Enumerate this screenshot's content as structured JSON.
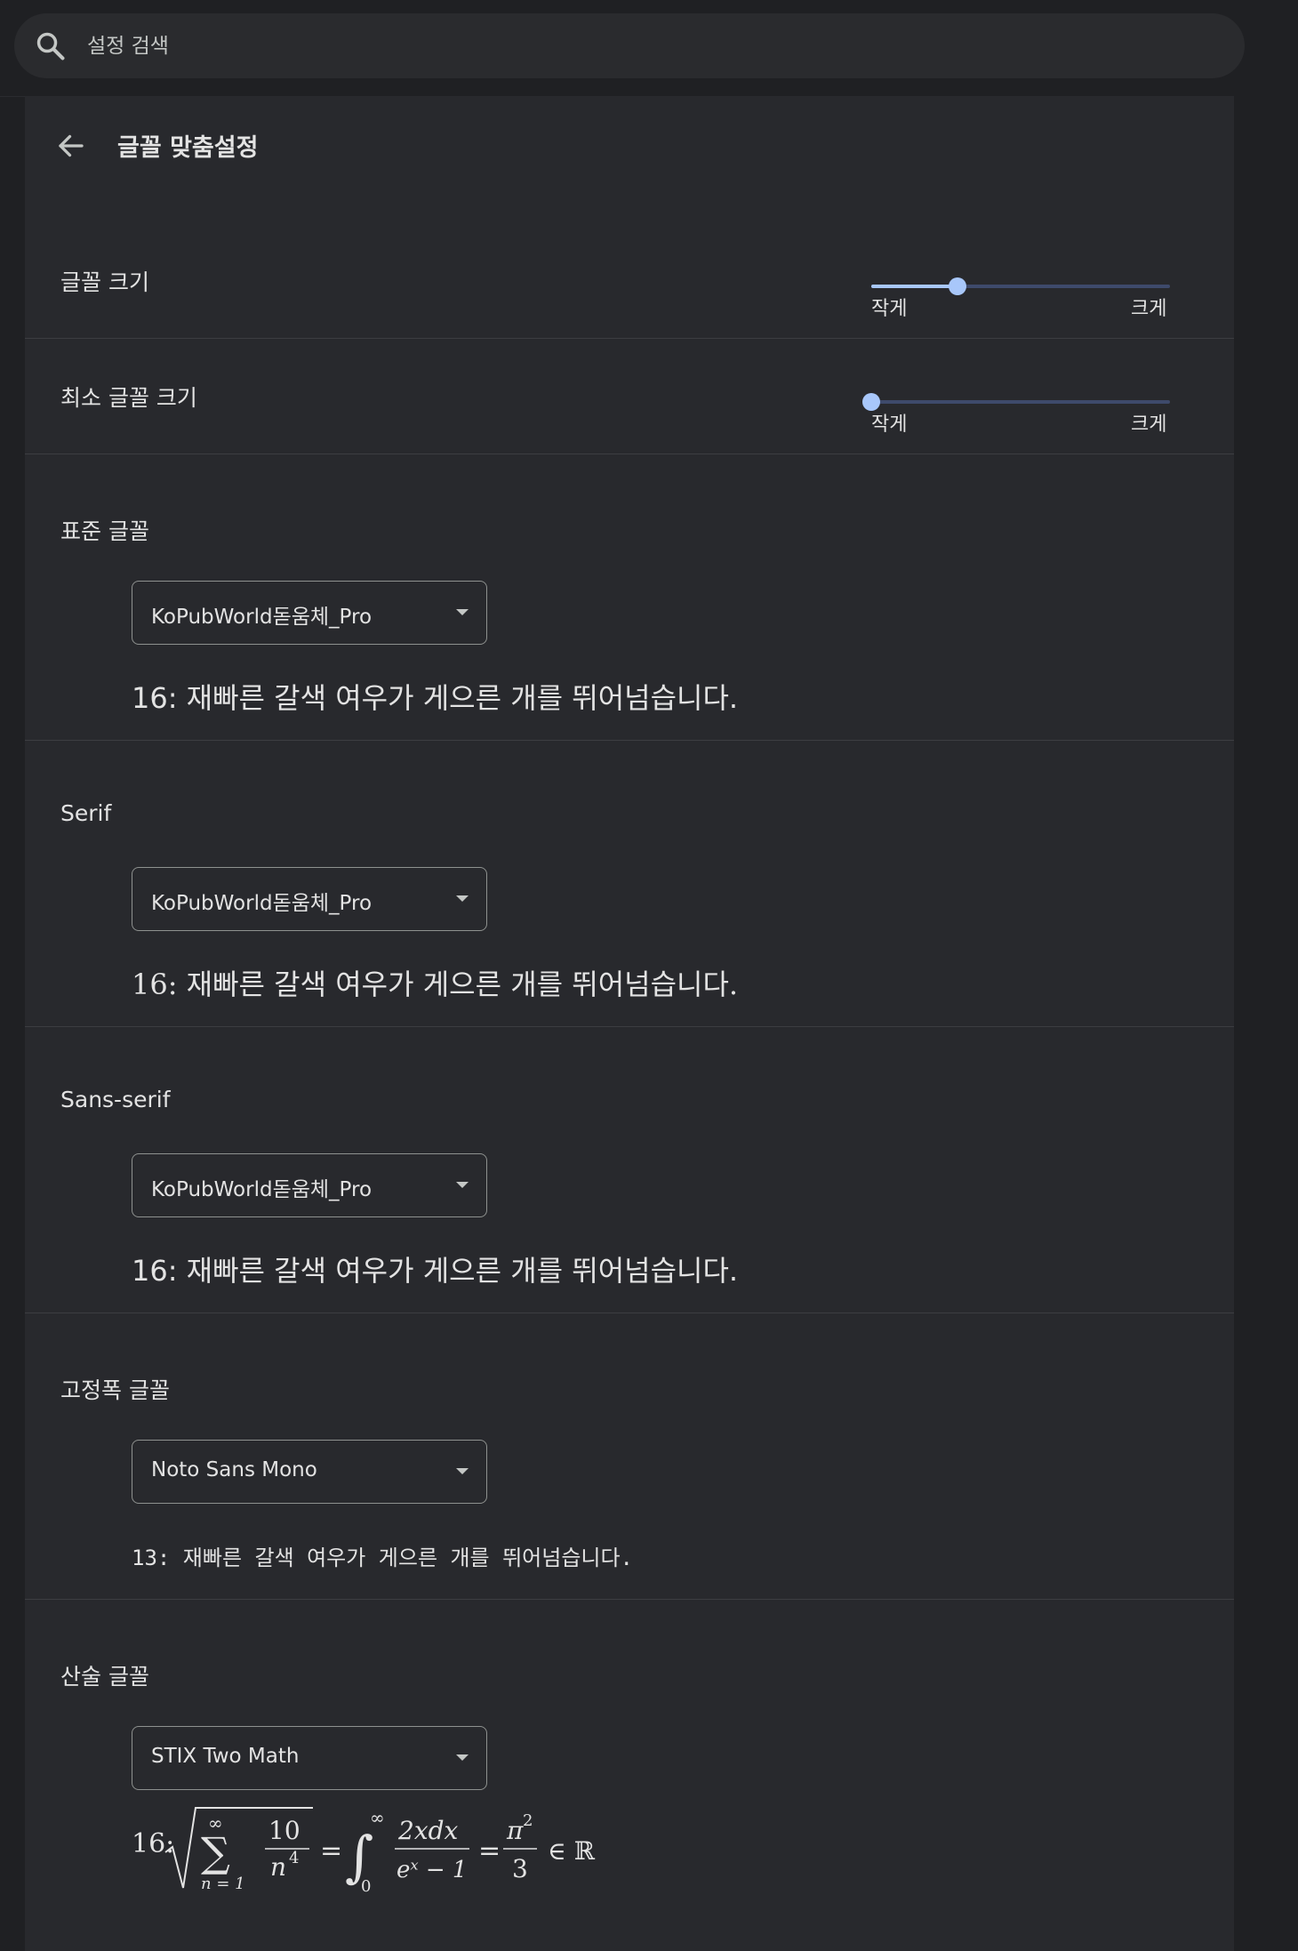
{
  "search": {
    "placeholder": "설정 검색"
  },
  "header": {
    "title": "글꼴 맞춤설정"
  },
  "font_size": {
    "label": "글꼴 크기",
    "min_label": "작게",
    "max_label": "크게",
    "value_fraction": 0.29
  },
  "min_font_size": {
    "label": "최소 글꼴 크기",
    "min_label": "작게",
    "max_label": "크게",
    "value_fraction": 0.0
  },
  "standard_font": {
    "label": "표준 글꼴",
    "selected": "KoPubWorld돋움체_Pro",
    "sample": "16: 재빠른 갈색 여우가 게으른 개를 뛰어넘습니다."
  },
  "serif_font": {
    "label": "Serif",
    "selected": "KoPubWorld돋움체_Pro",
    "sample": "16: 재빠른 갈색 여우가 게으른 개를 뛰어넘습니다."
  },
  "sans_serif_font": {
    "label": "Sans-serif",
    "selected": "KoPubWorld돋움체_Pro",
    "sample": "16: 재빠른 갈색 여우가 게으른 개를 뛰어넘습니다."
  },
  "fixed_width_font": {
    "label": "고정폭 글꼴",
    "selected": "Noto Sans Mono",
    "sample": "13: 재빠른 갈색 여우가 게으른 개를 뛰어넘습니다."
  },
  "math_font": {
    "label": "산술 글꼴",
    "selected": "STIX Two Math",
    "sample_prefix": "16:",
    "sum_top": "∞",
    "sum_symbol": "∑",
    "sum_bottom": "n = 1",
    "frac1_num": "10",
    "frac1_den": "n",
    "frac1_den_exp": "4",
    "equals": "=",
    "integral": "∫",
    "int_upper": "∞",
    "int_lower": "0",
    "frac2_num": "2xdx",
    "frac2_den": "eˣ − 1",
    "frac3_num": "π",
    "frac3_num_exp": "2",
    "frac3_den": "3",
    "element_of": "∈ ℝ"
  },
  "colors": {
    "background": "#1f2023",
    "card": "#28292d",
    "accent": "#a8c7fa",
    "track": "#3e4a6b",
    "divider": "#3c3d41"
  }
}
